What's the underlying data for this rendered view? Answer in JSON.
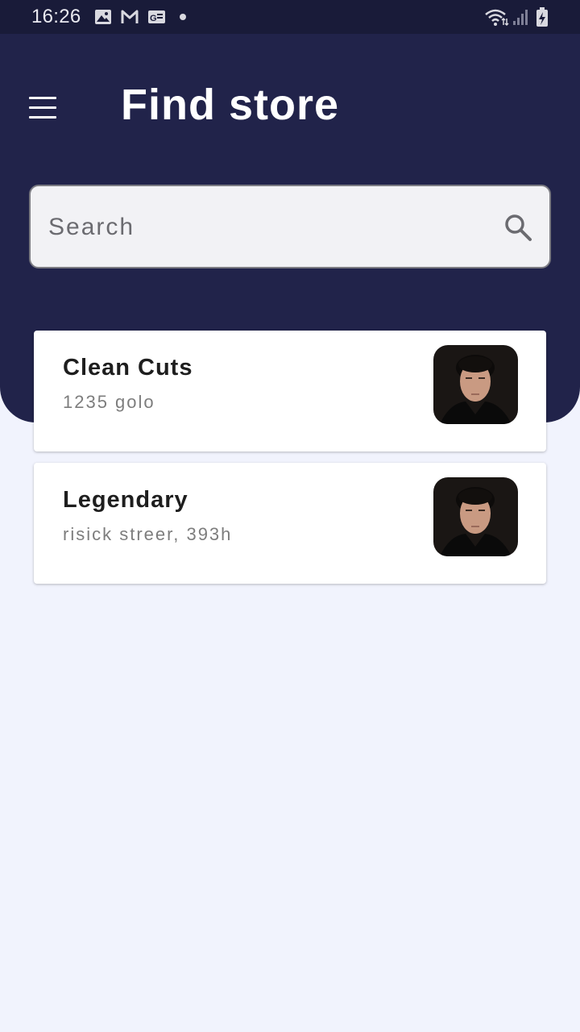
{
  "status_bar": {
    "time": "16:26",
    "icons": [
      "image-icon",
      "gmail-icon",
      "news-icon",
      "dot-icon",
      "wifi-icon",
      "signal-icon",
      "battery-charging-icon"
    ]
  },
  "header": {
    "title": "Find store",
    "menu_icon": "hamburger-menu-icon",
    "background_color": "#21234a"
  },
  "search": {
    "placeholder": "Search",
    "value": "",
    "icon": "search-icon"
  },
  "stores": [
    {
      "name": "Clean Cuts",
      "address": "1235 golo",
      "avatar": "store-photo"
    },
    {
      "name": "Legendary",
      "address": "risick streer, 393h",
      "avatar": "store-photo"
    }
  ],
  "colors": {
    "status_bar": "#191b39",
    "header": "#21234a",
    "page_background": "#f1f3fd",
    "card": "#ffffff"
  }
}
